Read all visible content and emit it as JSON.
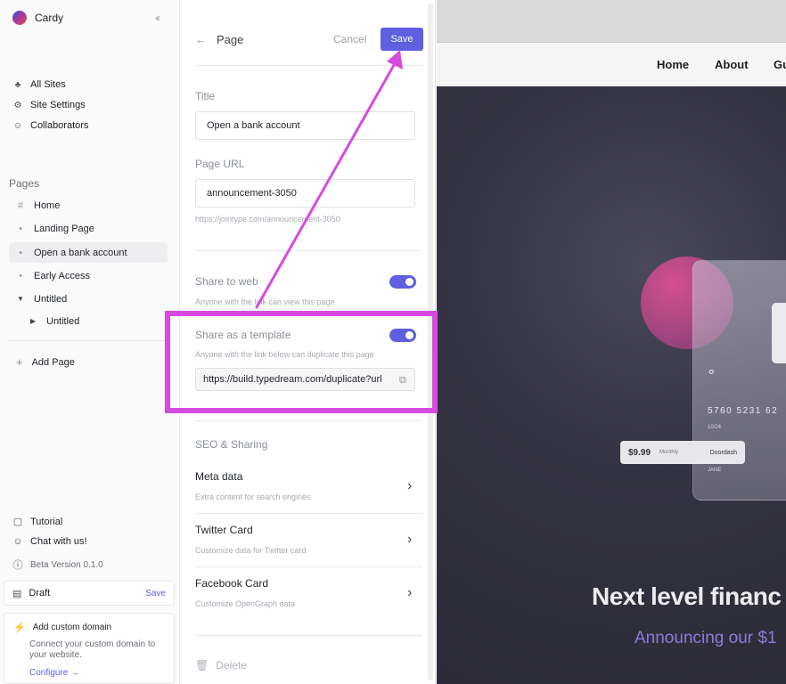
{
  "sidebar": {
    "app_name": "Cardy",
    "nav": [
      {
        "label": "All Sites",
        "icon": "sites-icon"
      },
      {
        "label": "Site Settings",
        "icon": "gear-icon"
      },
      {
        "label": "Collaborators",
        "icon": "users-icon"
      }
    ],
    "pages_label": "Pages",
    "pages": [
      {
        "label": "Home",
        "marker": "#"
      },
      {
        "label": "Landing Page",
        "marker": "•"
      },
      {
        "label": "Open a bank account",
        "marker": "•",
        "active": true
      },
      {
        "label": "Early Access",
        "marker": "•"
      },
      {
        "label": "Untitled",
        "marker": "▼",
        "expanded": true
      },
      {
        "label": "Untitled",
        "marker": "▶",
        "child": true
      }
    ],
    "add_page": "Add Page",
    "footer": {
      "tutorial": "Tutorial",
      "chat": "Chat with us!",
      "version": "Beta Version 0.1.0"
    },
    "draft": {
      "label": "Draft",
      "save": "Save"
    },
    "custom_domain": {
      "title": "Add custom domain",
      "description": "Connect your custom domain to your website.",
      "link": "Configure →"
    }
  },
  "panel": {
    "back_title": "Page",
    "cancel": "Cancel",
    "save": "Save",
    "title_label": "Title",
    "title_value": "Open a bank account",
    "url_label": "Page URL",
    "url_value": "announcement-3050",
    "url_hint": "https://jointype.com/announcement-3050",
    "share_web": {
      "label": "Share to web",
      "hint": "Anyone with the link can view this page",
      "enabled": true
    },
    "share_template": {
      "label": "Share as a template",
      "hint": "Anyone with the link below can duplicate this page",
      "enabled": true,
      "url": "https://build.typedream.com/duplicate?url"
    },
    "seo_label": "SEO & Sharing",
    "rows": [
      {
        "title": "Meta data",
        "subtitle": "Extra content for search engines"
      },
      {
        "title": "Twitter Card",
        "subtitle": "Customize data for Twitter card"
      },
      {
        "title": "Facebook Card",
        "subtitle": "Customize OpenGraph data"
      }
    ],
    "delete": "Delete"
  },
  "preview": {
    "nav": [
      "Home",
      "About",
      "Gu"
    ],
    "card": {
      "number": "5760 5231 62",
      "expiry": "10/24",
      "name": "JANE"
    },
    "notification": {
      "price": "$9.99",
      "frequency": "Monthly",
      "merchant": "Doordash"
    },
    "hero_title": "Next level financ",
    "hero_subtitle": "Announcing our $1"
  },
  "colors": {
    "accent": "#5f5fe0",
    "annotation": "#d54bdf"
  }
}
